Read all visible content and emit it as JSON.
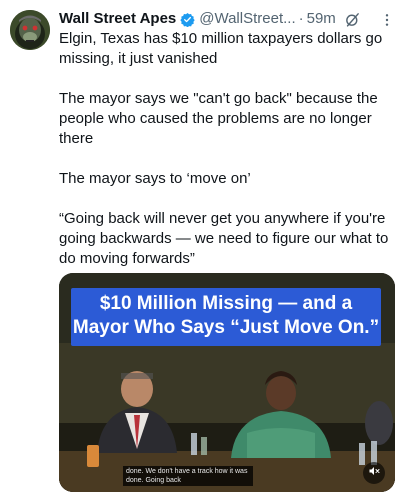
{
  "author": {
    "display_name": "Wall Street Apes",
    "handle": "@WallStreet...",
    "time": "59m",
    "separator": "·"
  },
  "body": {
    "paragraphs": [
      "Elgin, Texas has $10 million taxpayers dollars go missing, it just vanished",
      "The mayor says we \"can't go back\" because the people who caused the problems are no longer there",
      "The mayor says to ‘move on’",
      "“Going back will never get you anywhere if you're going backwards — we need to figure our what to do moving forwards”"
    ]
  },
  "media": {
    "headline": "$10 Million Missing — and a Mayor Who Says “Just Move On.”",
    "caption": "done. We don't have a track how it was done. Going back"
  },
  "icons": {
    "verified": "verified-badge-icon",
    "grok": "grok-icon",
    "more": "more-icon",
    "mute": "mute-icon"
  },
  "colors": {
    "verified_blue": "#1d9bf0",
    "headline_bg": "#2c5bd6",
    "secondary_text": "#536471"
  }
}
